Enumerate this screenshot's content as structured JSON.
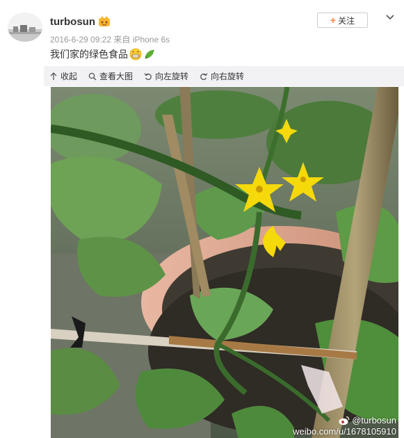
{
  "user": {
    "name": "turbosun"
  },
  "post": {
    "timestamp": "2016-6-29 09:22",
    "source_prefix": "来自",
    "source": "iPhone 6s",
    "text": "我们家的绿色食品"
  },
  "actions": {
    "follow_label": "关注"
  },
  "toolbar": {
    "items": [
      {
        "label": "收起",
        "icon": "collapse-icon"
      },
      {
        "label": "查看大图",
        "icon": "search-icon"
      },
      {
        "label": "向左旋转",
        "icon": "rotate-left-icon"
      },
      {
        "label": "向右旋转",
        "icon": "rotate-right-icon"
      }
    ]
  },
  "image": {
    "watermark_handle": "@turbosun",
    "watermark_url": "weibo.com/u/1678105910"
  },
  "colors": {
    "accent": "#ff8140",
    "toolbar_bg": "#f2f2f5",
    "meta": "#999999"
  }
}
